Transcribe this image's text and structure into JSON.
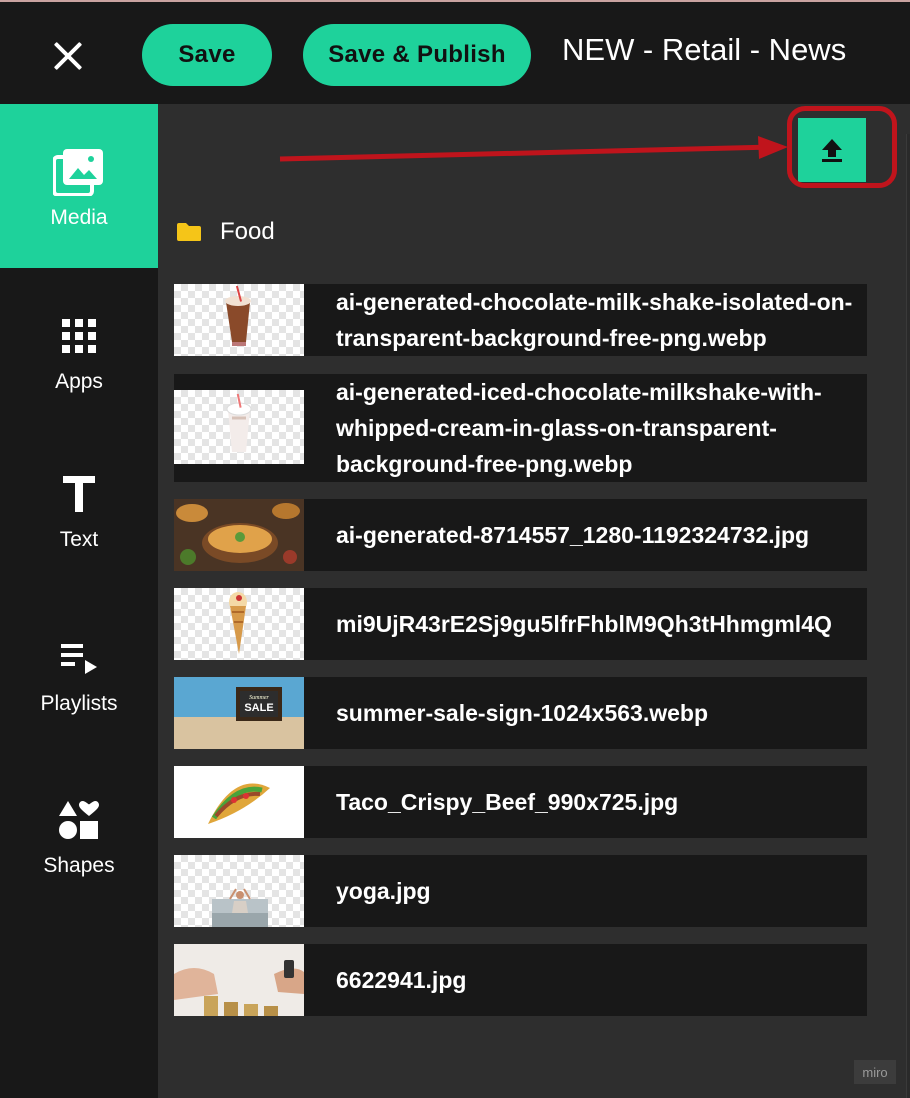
{
  "header": {
    "save_label": "Save",
    "publish_label": "Save & Publish",
    "title": "NEW - Retail - News"
  },
  "sidebar": {
    "items": [
      {
        "label": "Media",
        "icon": "media-icon",
        "active": true
      },
      {
        "label": "Apps",
        "icon": "apps-grid-icon",
        "active": false
      },
      {
        "label": "Text",
        "icon": "text-icon",
        "active": false
      },
      {
        "label": "Playlists",
        "icon": "playlist-icon",
        "active": false
      },
      {
        "label": "Shapes",
        "icon": "shapes-icon",
        "active": false
      }
    ]
  },
  "panel": {
    "upload_icon": "upload-icon",
    "folder": {
      "label": "Food",
      "icon": "folder-icon"
    },
    "files": [
      {
        "name": "ai-generated-chocolate-milk-shake-isolated-on-\ntransparent-background-free-png.webp",
        "thumb": "chocolate-milkshake"
      },
      {
        "name": "ai-generated-iced-chocolate-milkshake-with-\nwhipped-cream-in-glass-on-transparent-\nbackground-free-png.webp",
        "thumb": "iced-milkshake"
      },
      {
        "name": "ai-generated-8714557_1280-1192324732.jpg",
        "thumb": "soup-bowl"
      },
      {
        "name": "mi9UjR43rE2Sj9gu5lfrFhblM9Qh3tHhmgml4Q",
        "thumb": "ice-cream-cone"
      },
      {
        "name": "summer-sale-sign-1024x563.webp",
        "thumb": "summer-sale-sign"
      },
      {
        "name": "Taco_Crispy_Beef_990x725.jpg",
        "thumb": "taco"
      },
      {
        "name": "yoga.jpg",
        "thumb": "yoga"
      },
      {
        "name": "6622941.jpg",
        "thumb": "coins-hand"
      }
    ]
  },
  "watermark": "miro",
  "colors": {
    "accent": "#1ed29b",
    "topbar": "#181818",
    "panel": "#2e2e2e",
    "annotation": "#c0141c"
  }
}
